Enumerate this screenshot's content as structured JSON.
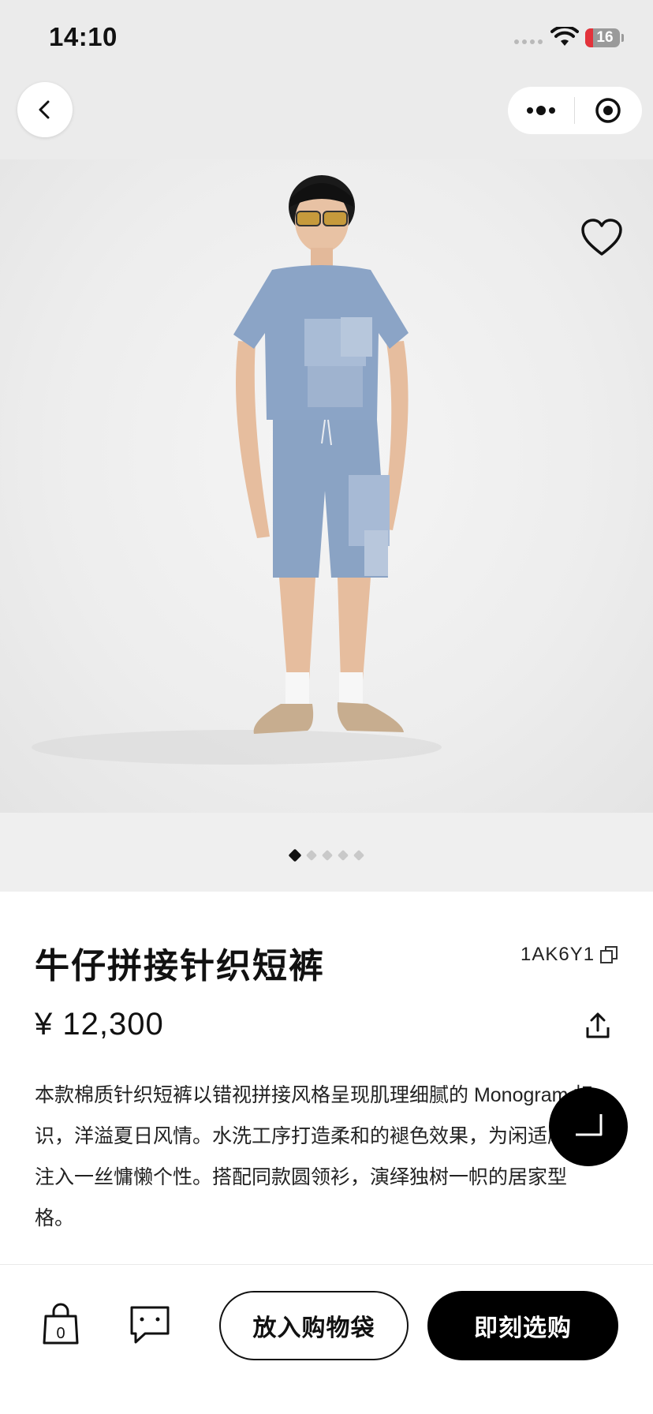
{
  "status_bar": {
    "time": "14:10",
    "battery": "16"
  },
  "nav": {
    "back_icon": "chevron-left-icon",
    "more_icon": "more-dots-icon",
    "miniapp_icon": "target-icon"
  },
  "product": {
    "image_alt": "模特穿着牛仔拼接针织短裤与同款短袖",
    "title": "牛仔拼接针织短裤",
    "sku": "1AK6Y1",
    "price": "¥ 12,300",
    "description": "本款棉质针织短裤以错视拼接风格呈现肌理细腻的 Monogram 标识，洋溢夏日风情。水洗工序打造柔和的褪色效果，为闲适廓形注入一丝慵懒个性。搭配同款圆领衫，演绎独树一帜的居家型格。",
    "gallery_total": 5,
    "gallery_active": 1
  },
  "actions": {
    "add_to_bag": "放入购物袋",
    "buy_now": "即刻选购",
    "bag_count": "0"
  },
  "colors": {
    "accent": "#000000",
    "denim": "#8aa3c4",
    "background": "#ebebeb"
  }
}
